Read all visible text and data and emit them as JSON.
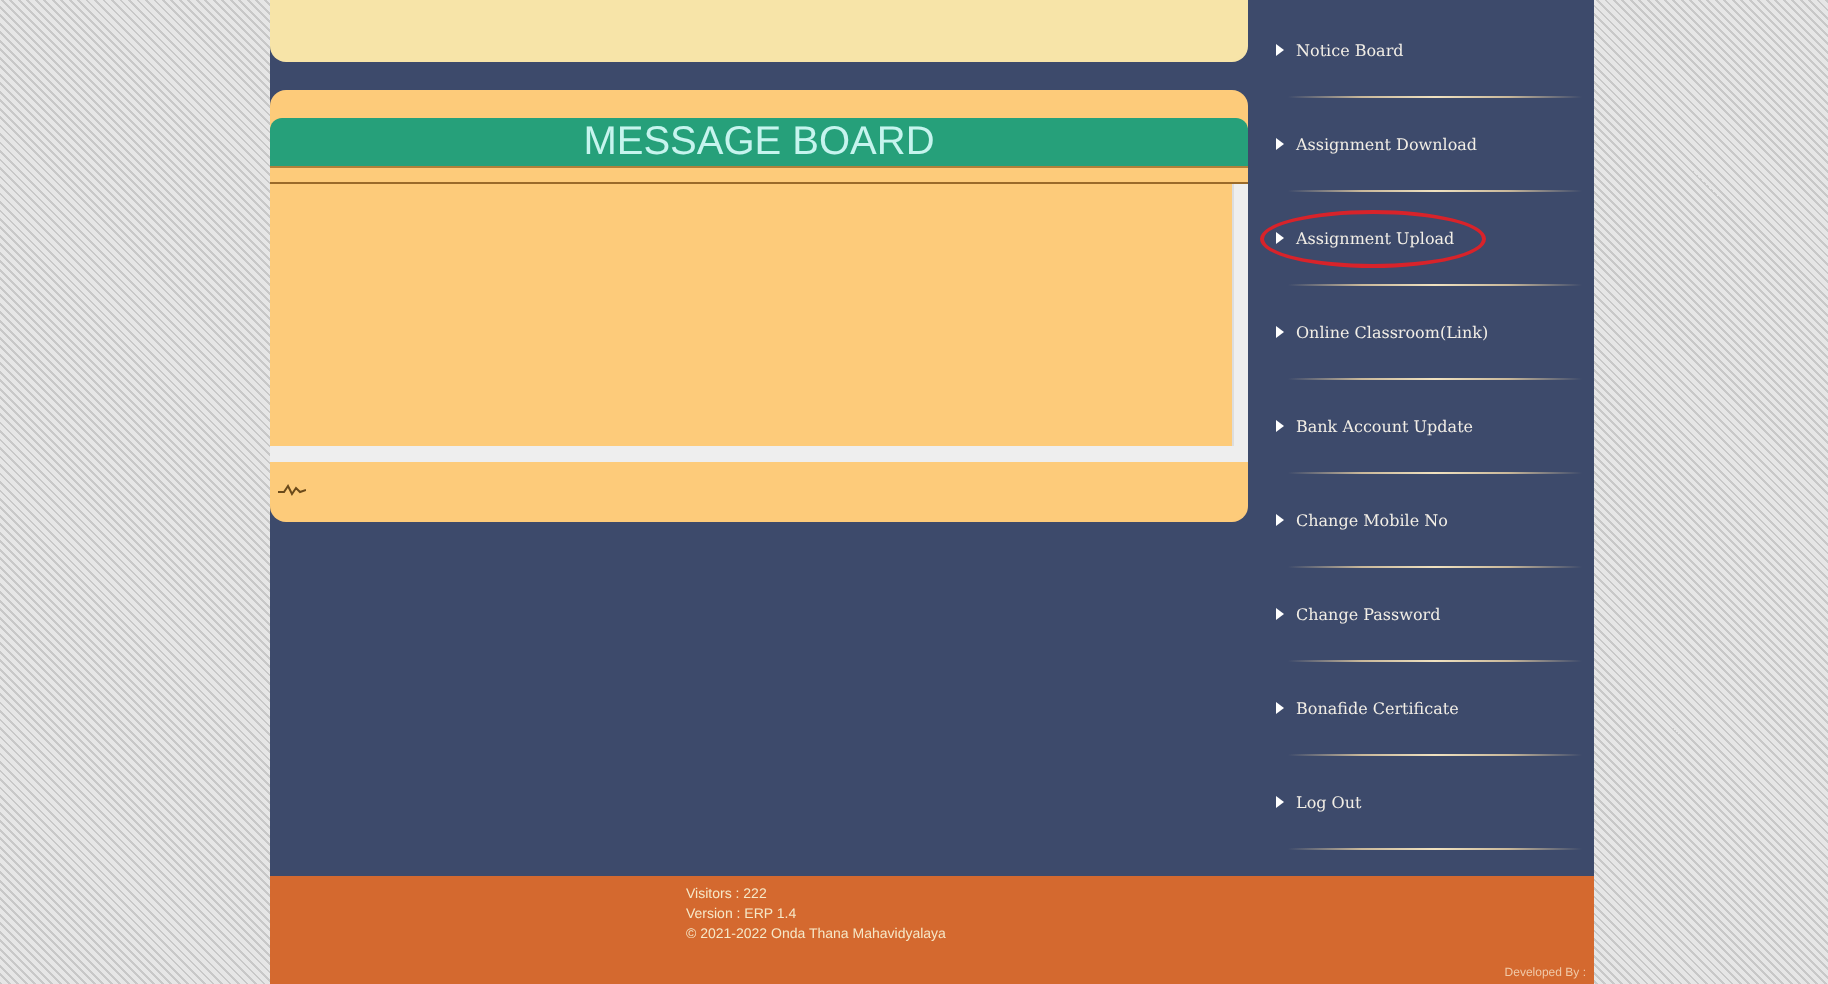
{
  "message_board": {
    "title": "MESSAGE BOARD"
  },
  "sidebar": {
    "items": [
      {
        "label": "Notice Board",
        "circled": false
      },
      {
        "label": "Assignment Download",
        "circled": false
      },
      {
        "label": "Assignment Upload",
        "circled": true
      },
      {
        "label": "Online Classroom(Link)",
        "circled": false
      },
      {
        "label": "Bank Account Update",
        "circled": false
      },
      {
        "label": "Change Mobile No",
        "circled": false
      },
      {
        "label": "Change Password",
        "circled": false
      },
      {
        "label": "Bonafide Certificate",
        "circled": false
      },
      {
        "label": "Log Out",
        "circled": false
      }
    ]
  },
  "footer": {
    "lines": [
      "Visitors : 222",
      "Version : ERP 1.4",
      "© 2021-2022  Onda Thana Mahavidyalaya"
    ],
    "credit": "Developed By :"
  }
}
